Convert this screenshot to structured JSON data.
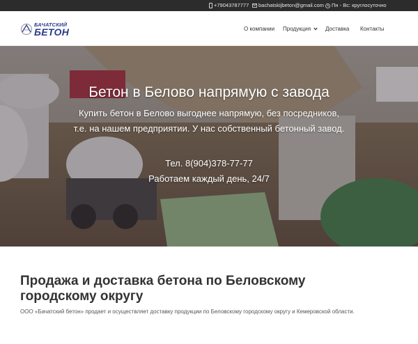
{
  "topbar": {
    "phone": "+79043787777",
    "email": "bachatskijbeton@gmail.com",
    "hours": "Пн - Вс: круглосуточно"
  },
  "logo": {
    "line1": "БАЧАТСКИЙ",
    "line2": "БЕТОН"
  },
  "nav": {
    "items": [
      {
        "label": "О компании"
      },
      {
        "label": "Продукция"
      },
      {
        "label": "Доставка"
      },
      {
        "label": "Контакты"
      }
    ]
  },
  "hero": {
    "title": "Бетон в Белово напрямую с завода",
    "subtitle_line1": "Купить бетон в Белово выгоднее напрямую, без посредников,",
    "subtitle_line2": "т.е. на нашем предприятии. У нас собственный бетонный завод.",
    "phone": "Тел. 8(904)378-77-77",
    "hours": "Работаем каждый день, 24/7"
  },
  "content": {
    "title": "Продажа и доставка бетона по Беловскому городскому округу",
    "text": "ООО «Бачатский бетон» продает и осуществляет доставку продукции по Беловскому городскому округу и Кемеровской области."
  },
  "colors": {
    "topbar_bg": "#2c2c2c",
    "brand": "#2a3a8a"
  }
}
